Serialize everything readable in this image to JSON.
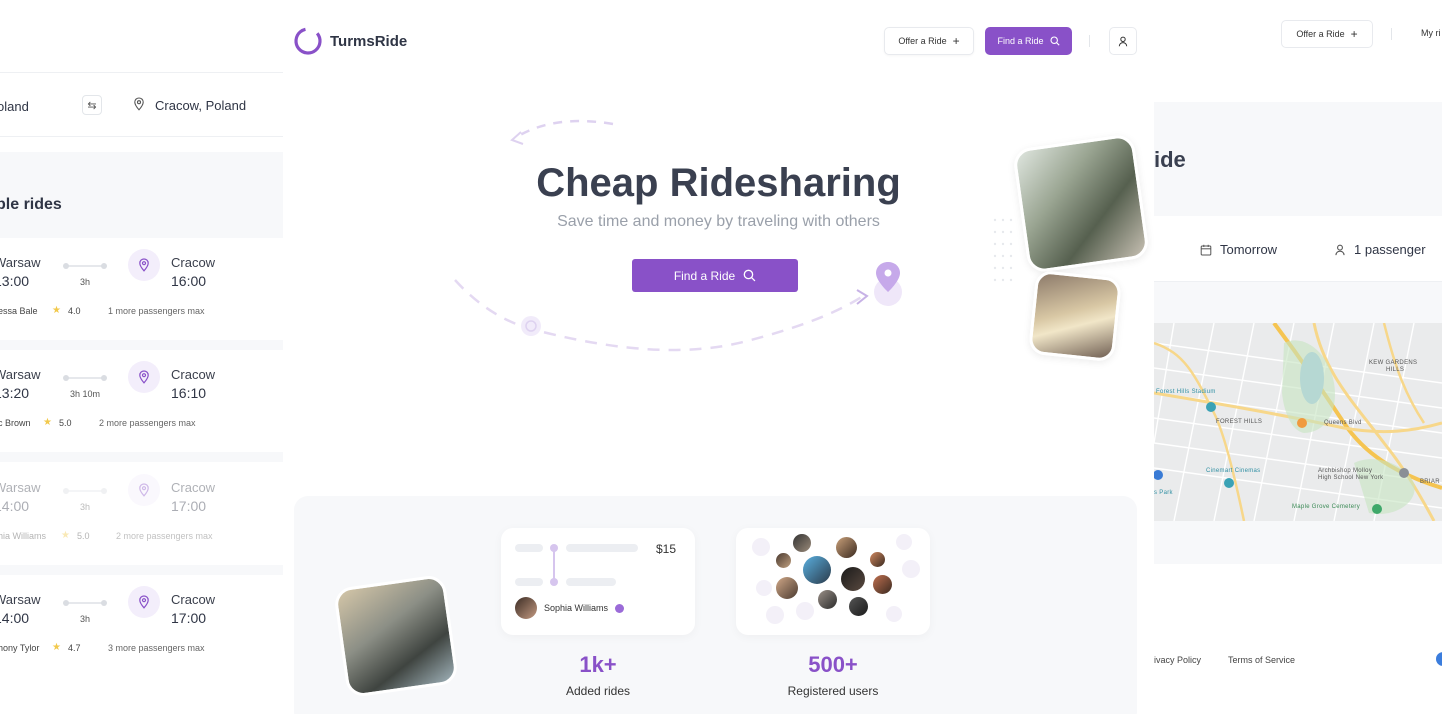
{
  "left_panel": {
    "from_city": "oland",
    "to_city": "Cracow, Poland",
    "heading": "ble rides",
    "rides": [
      {
        "from": "Warsaw",
        "dep": "13:00",
        "duration": "3h",
        "to": "Cracow",
        "arr": "16:00",
        "driver": "essa Bale",
        "rating": "4.0",
        "seats": "1 more passengers max"
      },
      {
        "from": "Warsaw",
        "dep": "13:20",
        "duration": "3h 10m",
        "to": "Cracow",
        "arr": "16:10",
        "driver": "c Brown",
        "rating": "5.0",
        "seats": "2 more passengers max"
      },
      {
        "from": "Warsaw",
        "dep": "14:00",
        "duration": "3h",
        "to": "Cracow",
        "arr": "17:00",
        "driver": "hia Williams",
        "rating": "5.0",
        "seats": "2 more passengers max"
      },
      {
        "from": "Warsaw",
        "dep": "14:00",
        "duration": "3h",
        "to": "Cracow",
        "arr": "17:00",
        "driver": "hony Tylor",
        "rating": "4.7",
        "seats": "3 more passengers max"
      }
    ]
  },
  "center": {
    "logo": "TurmsRide",
    "nav": {
      "offer": "Offer a Ride",
      "find": "Find a Ride"
    },
    "hero": {
      "title": "Cheap Ridesharing",
      "subtitle": "Save time and money by traveling with others",
      "cta": "Find a Ride"
    },
    "cards": {
      "price": "$15",
      "driver_name": "Sophia Williams"
    },
    "stats": [
      {
        "value": "1k+",
        "label": "Added rides"
      },
      {
        "value": "500+",
        "label": "Registered users"
      }
    ]
  },
  "right_panel": {
    "nav_offer": "Offer a Ride",
    "nav_my": "My ri",
    "heading": "ide",
    "date": "Tomorrow",
    "passengers": "1 passenger",
    "map_labels": {
      "kew": "KEW GARDENS",
      "hills": "HILLS",
      "stadium": "Forest Hills Stadium",
      "forest_hills": "FOREST HILLS",
      "cinemas": "Cinemart Cinemas",
      "archbishop": "Archbishop Molloy",
      "archbishop2": "High School New York",
      "maple": "Maple Grove Cemetery",
      "briar": "BRIAR",
      "park": "s Park",
      "queens": "Queens Blvd"
    },
    "footer": {
      "privacy": "ivacy Policy",
      "terms": "Terms of Service"
    }
  },
  "colors": {
    "accent": "#8951c8",
    "star": "#f2c94c",
    "panel_bg": "#f7f8fa"
  }
}
